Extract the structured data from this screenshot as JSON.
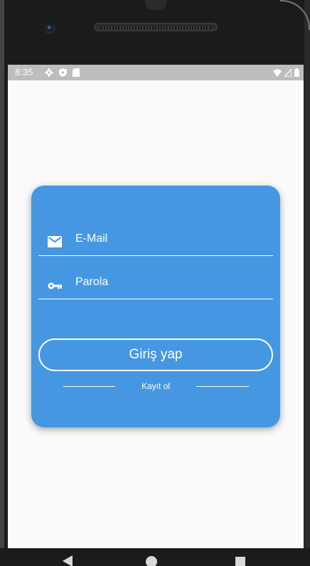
{
  "status_bar": {
    "time": "8:35",
    "left_icons": [
      "gear-icon",
      "shield-icon",
      "sd-card-icon"
    ],
    "right_icons": [
      "wifi-icon",
      "signal-icon",
      "battery-icon"
    ]
  },
  "login_card": {
    "background_color": "#4597e2",
    "email": {
      "placeholder": "E-Mail",
      "icon": "mail-icon"
    },
    "password": {
      "placeholder": "Parola",
      "icon": "key-icon"
    },
    "login_button_label": "Giriş yap",
    "register_link_label": "Kayıt ol"
  },
  "nav_bar": {
    "icons": [
      "back-icon",
      "home-icon",
      "recents-icon"
    ]
  }
}
